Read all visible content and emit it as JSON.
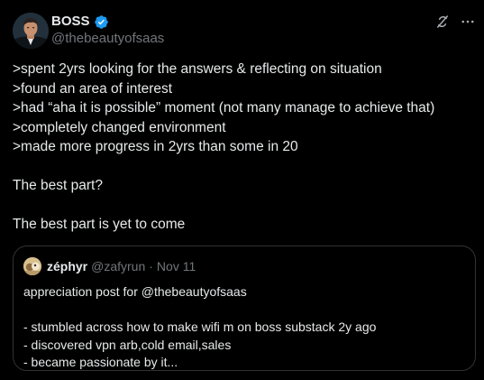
{
  "author": {
    "display_name": "BOSS",
    "handle": "@thebeautyofsaas",
    "verified": true,
    "verified_color": "#1d9bf0"
  },
  "post": {
    "lines": [
      ">spent 2yrs looking for the answers & reflecting on situation",
      ">found an area of interest",
      ">had “aha it is possible” moment (not many manage to achieve that)",
      ">completely changed environment",
      ">made more progress in 2yrs than some in 20",
      "The best part?",
      "The best part is yet to come"
    ]
  },
  "quote": {
    "display_name": "zéphyr",
    "handle": "@zafyrun",
    "separator": "·",
    "date": "Nov 11",
    "lines": [
      "appreciation post for @thebeautyofsaas",
      "- stumbled across how to make wifi m on boss substack 2y ago",
      "- discovered vpn arb,cold email,sales",
      "- became passionate by it..."
    ]
  },
  "icons": {
    "grok": "grok-icon",
    "more": "more-horizontal-icon",
    "verified": "verified-badge-icon"
  },
  "colors": {
    "background": "#000000",
    "text_primary": "#e7e9ea",
    "text_secondary": "#71767b",
    "border": "#2f3336"
  }
}
